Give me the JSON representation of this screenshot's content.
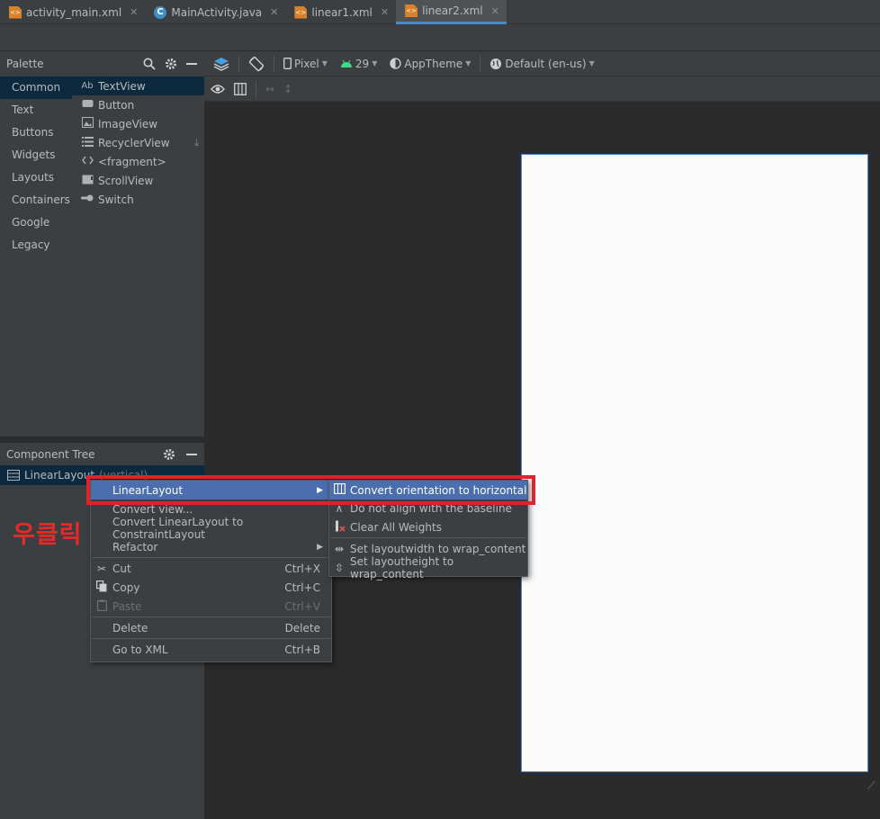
{
  "tabs": [
    {
      "label": "activity_main.xml",
      "type": "xml",
      "active": false
    },
    {
      "label": "MainActivity.java",
      "type": "java",
      "active": false
    },
    {
      "label": "linear1.xml",
      "type": "xml",
      "active": false
    },
    {
      "label": "linear2.xml",
      "type": "xml",
      "active": true
    }
  ],
  "palette": {
    "title": "Palette",
    "categories": [
      "Common",
      "Text",
      "Buttons",
      "Widgets",
      "Layouts",
      "Containers",
      "Google",
      "Legacy"
    ],
    "items": [
      {
        "icon": "Ab",
        "label": "TextView"
      },
      {
        "icon": "button-icon",
        "label": "Button"
      },
      {
        "icon": "image-icon",
        "label": "ImageView"
      },
      {
        "icon": "list-icon",
        "label": "RecyclerView"
      },
      {
        "icon": "code-icon",
        "label": "<fragment>"
      },
      {
        "icon": "scroll-icon",
        "label": "ScrollView"
      },
      {
        "icon": "switch-icon",
        "label": "Switch"
      }
    ]
  },
  "component_tree": {
    "title": "Component Tree",
    "root": {
      "label": "LinearLayout",
      "detail": "(vertical)"
    }
  },
  "design_toolbar": {
    "device": "Pixel",
    "api": "29",
    "theme": "AppTheme",
    "locale": "Default (en-us)"
  },
  "context_menu": {
    "items": [
      {
        "label": "LinearLayout",
        "submenu": true,
        "active": true
      },
      {
        "label": "Convert view...",
        "shortcut": ""
      },
      {
        "label": "Convert LinearLayout to ConstraintLayout",
        "shortcut": ""
      },
      {
        "label": "Refactor",
        "submenu": true
      },
      {
        "label": "Cut",
        "shortcut": "Ctrl+X",
        "icon": "scissors-icon"
      },
      {
        "label": "Copy",
        "shortcut": "Ctrl+C",
        "icon": "copy-icon"
      },
      {
        "label": "Paste",
        "shortcut": "Ctrl+V",
        "icon": "paste-icon",
        "disabled": true
      },
      {
        "label": "Delete",
        "shortcut": "Delete"
      },
      {
        "label": "Go to XML",
        "shortcut": "Ctrl+B"
      }
    ]
  },
  "submenu": {
    "items": [
      {
        "label": "Convert orientation to horizontal",
        "active": true
      },
      {
        "label": "Do not align with the baseline"
      },
      {
        "label": "Clear All Weights"
      },
      {
        "label": "Set layoutwidth to wrap_content"
      },
      {
        "label": "Set layoutheight to wrap_content"
      }
    ]
  },
  "annotation": "우클릭",
  "colors": {
    "highlight": "#e0222a",
    "selection": "#4b6eaf",
    "annotation": "#e52a2a"
  }
}
